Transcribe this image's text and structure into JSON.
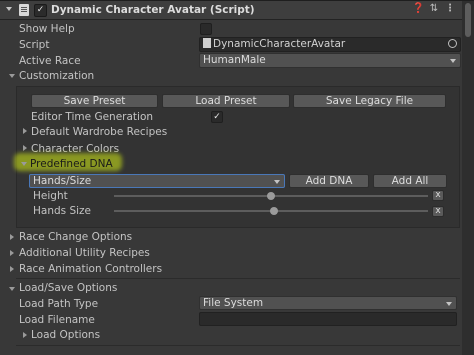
{
  "header": {
    "title": "Dynamic Character Avatar (Script)",
    "help_icon": "question-icon",
    "preset_icon": "sliders-icon",
    "menu_icon": "kebab-icon"
  },
  "props": {
    "show_help_label": "Show Help",
    "script_label": "Script",
    "script_value": "DynamicCharacterAvatar",
    "active_race_label": "Active Race",
    "active_race_value": "HumanMale"
  },
  "customization": {
    "label": "Customization",
    "save_preset": "Save Preset",
    "load_preset": "Load Preset",
    "save_legacy": "Save Legacy File",
    "editor_time_generation": "Editor Time Generation",
    "default_wardrobe_recipes": "Default Wardrobe Recipes",
    "character_colors": "Character Colors",
    "predefined_dna": "Predefined DNA",
    "dna_selected": "Hands/Size",
    "add_dna": "Add DNA",
    "add_all": "Add All",
    "dna_items": [
      {
        "label": "Height",
        "value": 0.5,
        "remove": "x"
      },
      {
        "label": "Hands Size",
        "value": 0.51,
        "remove": "x"
      }
    ]
  },
  "sections": {
    "race_change": "Race Change Options",
    "additional_utility": "Additional Utility Recipes",
    "race_animation": "Race Animation Controllers",
    "load_save": "Load/Save Options"
  },
  "load_save": {
    "load_path_type_label": "Load Path Type",
    "load_path_type_value": "File System",
    "load_filename_label": "Load Filename",
    "load_filename_value": "",
    "load_options": "Load Options"
  },
  "colors": {
    "background": "#383838",
    "highlight": "#d2eb14",
    "accent_text": "#dcdcdc"
  }
}
